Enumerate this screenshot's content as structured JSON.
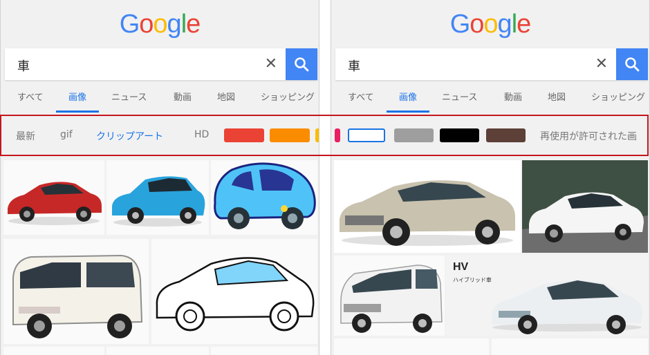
{
  "logo": {
    "letters": [
      "G",
      "o",
      "o",
      "g",
      "l",
      "e"
    ],
    "colors": [
      "#4285f4",
      "#ea4335",
      "#fbbc05",
      "#4285f4",
      "#34a853",
      "#ea4335"
    ]
  },
  "search": {
    "query": "車",
    "clear_glyph": "✕"
  },
  "tabs": [
    "すべて",
    "画像",
    "ニュース",
    "動画",
    "地図",
    "ショッピング"
  ],
  "active_tab": "画像",
  "left_tools": {
    "items": [
      "最新",
      "gif",
      "クリップアート",
      "HD"
    ],
    "active": "クリップアート",
    "swatches": [
      "#ea4335",
      "#fb8c00",
      "#fbbc05"
    ]
  },
  "right_tools": {
    "swatches": [
      "#e91e63",
      "#ffffff",
      "#9e9e9e",
      "#000000",
      "#5d4037"
    ],
    "license": "再使用が許可された画"
  },
  "right_images": {
    "hv_title": "HV",
    "hv_sub": "ハイブリッド車"
  },
  "colors": {
    "accent": "#1a73e8",
    "search_button": "#4285f4",
    "highlight": "#c4161c"
  }
}
